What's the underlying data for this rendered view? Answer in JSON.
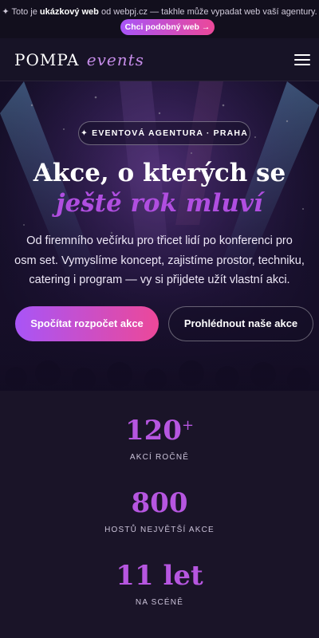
{
  "demo_banner": {
    "prefix": "✦ Toto je ",
    "bold": "ukázkový web",
    "suffix": " od webpj.cz — takhle může vypadat web vaší agentury.",
    "cta_label": "Chci podobný web →"
  },
  "header": {
    "logo_main": "POMPA",
    "logo_sub": "events"
  },
  "hero": {
    "badge": "✦ EVENTOVÁ AGENTURA · PRAHA",
    "title_line1": "Akce, o kterých se",
    "title_line2": "ještě rok mluví",
    "lead": "Od firemního večírku pro třicet lidí po konferenci pro osm set. Vymyslíme koncept, zajistíme prostor, techniku, catering i program — vy si přijdete užít vlastní akci.",
    "primary_button": "Spočítat rozpočet akce",
    "secondary_button": "Prohlédnout naše akce"
  },
  "stats": [
    {
      "value": "120",
      "suffix": "+",
      "label": "AKCÍ ROČNĚ"
    },
    {
      "value": "800",
      "suffix": "",
      "label": "HOSTŮ NEJVĚTŠÍ AKCE"
    },
    {
      "value": "11 let",
      "suffix": "",
      "label": "NA SCÉNĚ"
    }
  ],
  "colors": {
    "accent_start": "#a855f7",
    "accent_end": "#ec4899",
    "accent_text": "#b656e0",
    "background": "#171326"
  },
  "icons": {
    "menu": "hamburger-menu-icon",
    "sparkle": "sparkle-icon"
  }
}
